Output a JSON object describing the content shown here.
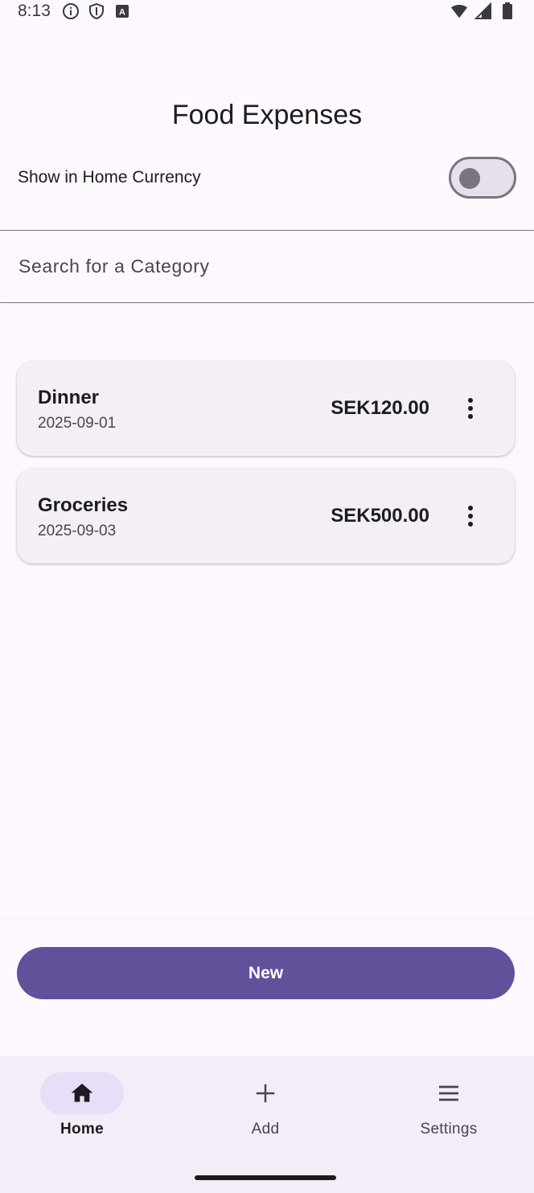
{
  "status_bar": {
    "time": "8:13",
    "icons_left": [
      "info-icon",
      "shield-icon",
      "keyboard-a-icon"
    ],
    "icons_right": [
      "wifi-icon",
      "signal-icon",
      "battery-icon"
    ]
  },
  "header": {
    "title": "Food Expenses"
  },
  "toggle": {
    "label": "Show in Home Currency",
    "checked": false
  },
  "search": {
    "placeholder": "Search for a Category",
    "value": ""
  },
  "expenses": [
    {
      "category": "Dinner",
      "date": "2025-09-01",
      "amount": "SEK120.00"
    },
    {
      "category": "Groceries",
      "date": "2025-09-03",
      "amount": "SEK500.00"
    }
  ],
  "actions": {
    "new_label": "New"
  },
  "bottom_nav": {
    "items": [
      {
        "label": "Home",
        "icon": "home-icon",
        "active": true
      },
      {
        "label": "Add",
        "icon": "plus-icon",
        "active": false
      },
      {
        "label": "Settings",
        "icon": "menu-icon",
        "active": false
      }
    ]
  },
  "colors": {
    "primary": "#62509b",
    "background": "#fdf8fd",
    "card": "#f4eff6",
    "nav_background": "#f3edf7",
    "nav_active_pill": "#e8def8"
  }
}
